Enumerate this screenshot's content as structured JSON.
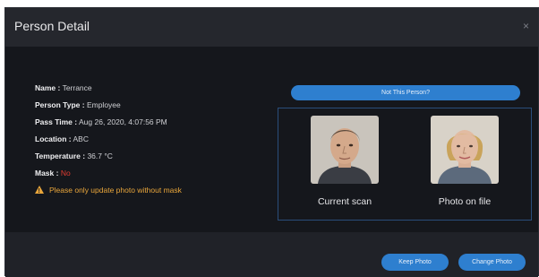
{
  "dialog": {
    "title": "Person Detail",
    "close_glyph": "×"
  },
  "info": {
    "name_label": "Name :",
    "name_value": "Terrance",
    "type_label": "Person Type :",
    "type_value": "Employee",
    "pass_label": "Pass Time :",
    "pass_value": "Aug 26, 2020, 4:07:56 PM",
    "location_label": "Location :",
    "location_value": "ABC",
    "temp_label": "Temperature :",
    "temp_value": "36.7 °C",
    "mask_label": "Mask :",
    "mask_value": "No",
    "warning": "Please only update photo without mask"
  },
  "compare": {
    "not_this_person": "Not This Person?",
    "current_caption": "Current scan",
    "file_caption": "Photo on file"
  },
  "footer": {
    "keep_label": "Keep Photo",
    "change_label": "Change Photo"
  },
  "colors": {
    "accent": "#2e7fcf",
    "warning": "#e9a63b",
    "mask_no": "#e03c31",
    "background": "#15171c"
  },
  "icons": {
    "warning": "warning-icon",
    "close": "close-icon"
  }
}
